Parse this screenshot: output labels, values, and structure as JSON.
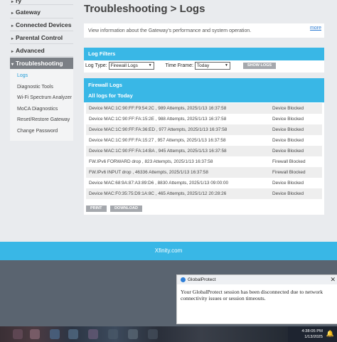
{
  "sidebar": {
    "items": [
      {
        "label": "ry"
      },
      {
        "label": "Gateway"
      },
      {
        "label": "Connected Devices"
      },
      {
        "label": "Parental Control"
      },
      {
        "label": "Advanced"
      },
      {
        "label": "Troubleshooting"
      }
    ],
    "sub_items": [
      {
        "label": "Logs"
      },
      {
        "label": "Diagnostic Tools"
      },
      {
        "label": "Wi-Fi Spectrum Analyzer"
      },
      {
        "label": "MoCA Diagnostics"
      },
      {
        "label": "Reset/Restore Gateway"
      },
      {
        "label": "Change Password"
      }
    ]
  },
  "main": {
    "title": "Troubleshooting > Logs",
    "info_text": "View information about the Gateway's performance and system operation.",
    "more_link": "more"
  },
  "filters": {
    "heading": "Log Filters",
    "log_type_label": "Log Type:",
    "log_type_value": "Firewall Logs",
    "time_frame_label": "Time Frame:",
    "time_frame_value": "Today",
    "show_logs_button": "SHOW LOGS"
  },
  "firewall": {
    "heading": "Firewall Logs",
    "subheading": "All logs for Today",
    "rows": [
      {
        "message": "Device MAC:1C:90:FF:F9:54:2C , 989 Attempts, 2025/1/13 16:37:58",
        "status": "Device Blocked"
      },
      {
        "message": "Device MAC:1C:90:FF:FA:15:2E , 988 Attempts, 2025/1/13 16:37:58",
        "status": "Device Blocked"
      },
      {
        "message": "Device MAC:1C:90:FF:FA:36:ED , 977 Attempts, 2025/1/13 16:37:58",
        "status": "Device Blocked"
      },
      {
        "message": "Device MAC:1C:90:FF:FA:15:27 , 957 Attempts, 2025/1/13 16:37:58",
        "status": "Device Blocked"
      },
      {
        "message": "Device MAC:1C:90:FF:FA:14:BA , 945 Attempts, 2025/1/13 16:37:58",
        "status": "Device Blocked"
      },
      {
        "message": "FW.IPv6 FORWARD drop , 823 Attempts, 2025/1/13 16:37:58",
        "status": "Firewall Blocked"
      },
      {
        "message": "FW.IPv6 INPUT drop , 46336 Attempts, 2025/1/13 16:37:58",
        "status": "Firewall Blocked"
      },
      {
        "message": "Device MAC:68:9A:87:A3:89:D6 , 8830 Attempts, 2025/1/13 09:00:00",
        "status": "Device Blocked"
      },
      {
        "message": "Device MAC:F0:35:75:D9:1A:8C , 465 Attempts, 2025/1/12 20:28:26",
        "status": "Device Blocked"
      }
    ],
    "print_button": "PRINT",
    "download_button": "DOWNLOAD"
  },
  "footer": {
    "text": "Xfinity.com"
  },
  "notification": {
    "app_name": "GlobalProtect",
    "message": "Your GlobalProtect session has been disconnected due to network connectivity issues or session timeouts.",
    "close_glyph": "✕"
  },
  "taskbar": {
    "time": "4:38:05 PM",
    "date": "1/13/2025"
  }
}
